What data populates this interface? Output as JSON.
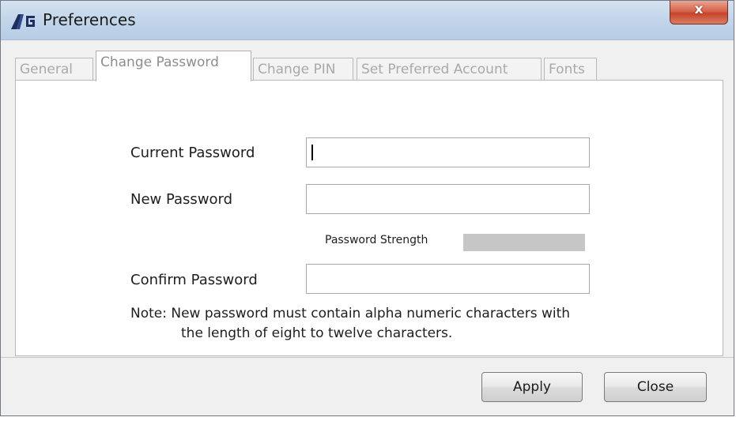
{
  "window": {
    "title": "Preferences",
    "close_glyph": "x",
    "logo_icon": "ag-logo-icon"
  },
  "tabs": [
    {
      "label": "General",
      "active": false
    },
    {
      "label": "Change Password",
      "active": true
    },
    {
      "label": "Change PIN",
      "active": false
    },
    {
      "label": "Set Preferred Account",
      "active": false
    },
    {
      "label": "Fonts",
      "active": false
    }
  ],
  "form": {
    "current_password": {
      "label": "Current Password",
      "value": ""
    },
    "new_password": {
      "label": "New Password",
      "value": ""
    },
    "strength": {
      "label": "Password Strength",
      "level": 0
    },
    "confirm_password": {
      "label": "Confirm Password",
      "value": ""
    },
    "note_line1": "Note: New password must contain alpha numeric characters with",
    "note_line2": "the length of eight to twelve characters."
  },
  "buttons": {
    "apply": "Apply",
    "close": "Close"
  },
  "colors": {
    "titlebar": "#c3d6ea",
    "close_button": "#c7432a",
    "strength_bar": "#c6c6c6"
  }
}
